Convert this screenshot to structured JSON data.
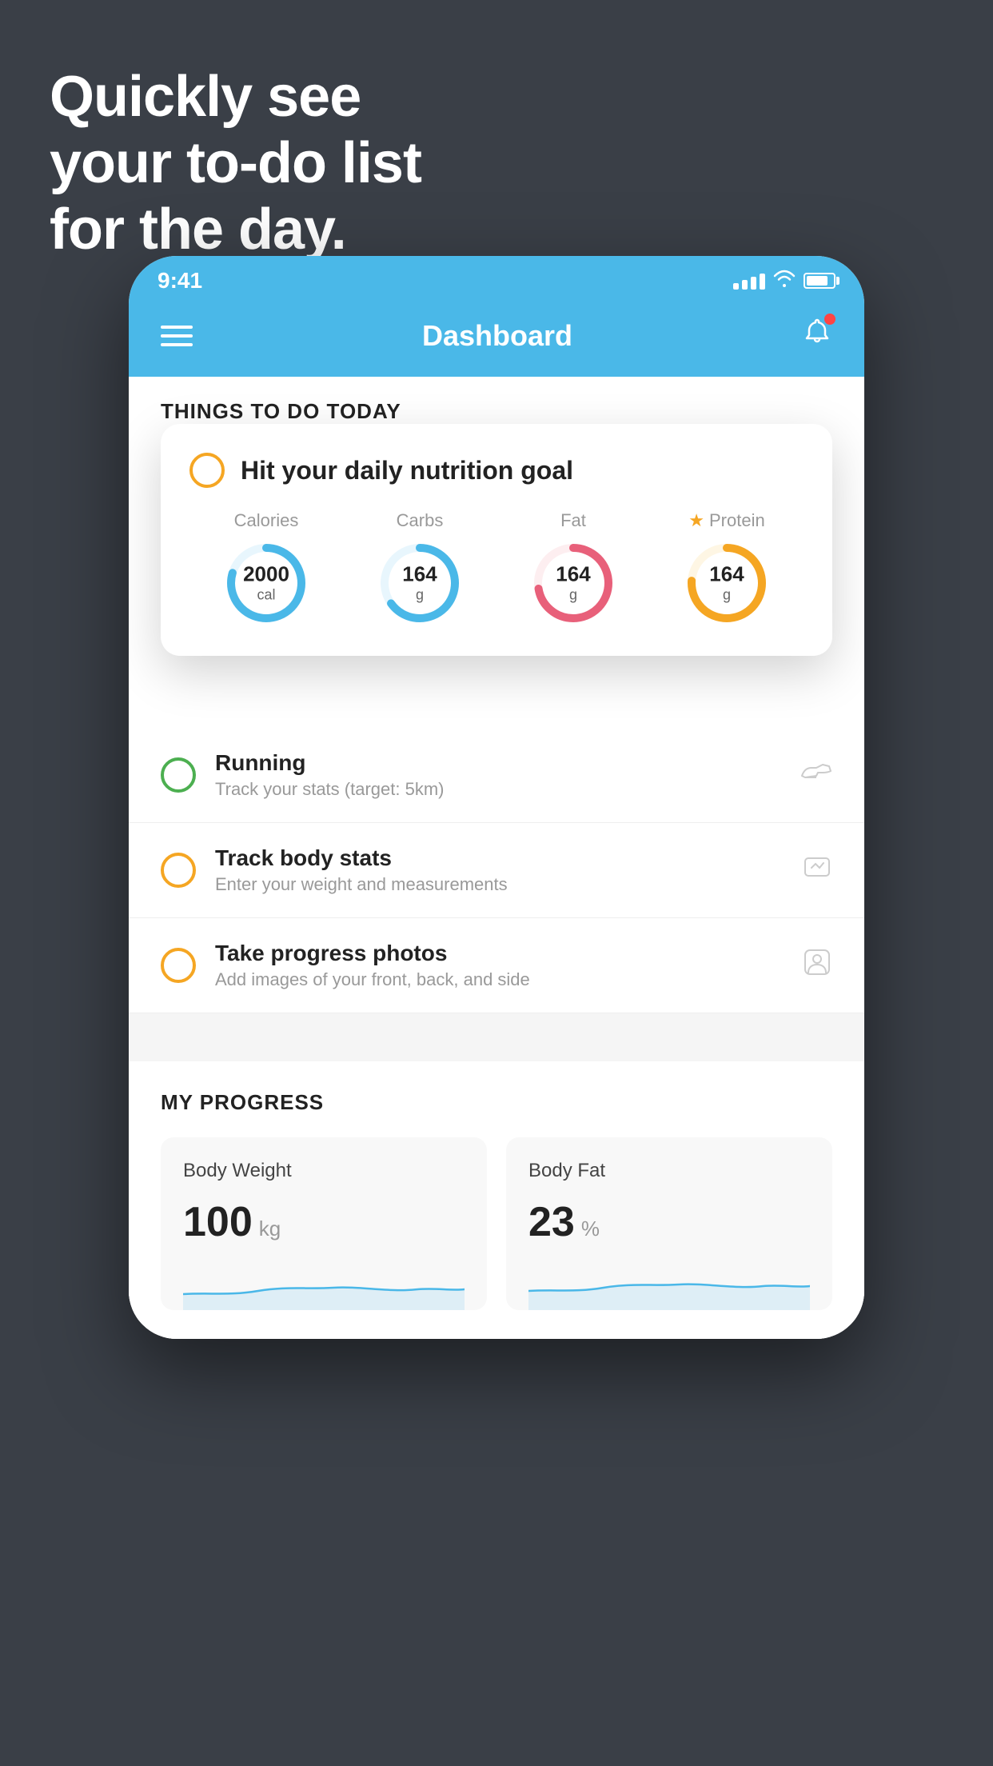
{
  "hero": {
    "line1": "Quickly see",
    "line2": "your to-do list",
    "line3": "for the day."
  },
  "status_bar": {
    "time": "9:41"
  },
  "header": {
    "title": "Dashboard"
  },
  "things_today": {
    "section_label": "THINGS TO DO TODAY"
  },
  "nutrition_card": {
    "circle_color": "#f5a623",
    "title": "Hit your daily nutrition goal",
    "items": [
      {
        "label": "Calories",
        "value": "2000",
        "unit": "cal",
        "color": "#4ab8e8",
        "star": false
      },
      {
        "label": "Carbs",
        "value": "164",
        "unit": "g",
        "color": "#4ab8e8",
        "star": false
      },
      {
        "label": "Fat",
        "value": "164",
        "unit": "g",
        "color": "#e8607a",
        "star": false
      },
      {
        "label": "Protein",
        "value": "164",
        "unit": "g",
        "color": "#f5a623",
        "star": true
      }
    ]
  },
  "todo_items": [
    {
      "circle_color": "green",
      "title": "Running",
      "subtitle": "Track your stats (target: 5km)",
      "icon": "shoe"
    },
    {
      "circle_color": "yellow",
      "title": "Track body stats",
      "subtitle": "Enter your weight and measurements",
      "icon": "scale"
    },
    {
      "circle_color": "yellow",
      "title": "Take progress photos",
      "subtitle": "Add images of your front, back, and side",
      "icon": "person"
    }
  ],
  "progress": {
    "section_label": "MY PROGRESS",
    "cards": [
      {
        "title": "Body Weight",
        "value": "100",
        "unit": "kg"
      },
      {
        "title": "Body Fat",
        "value": "23",
        "unit": "%"
      }
    ]
  }
}
